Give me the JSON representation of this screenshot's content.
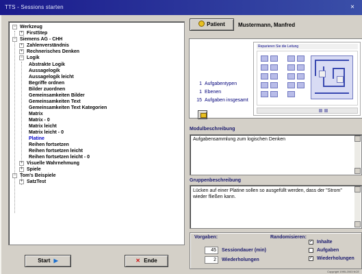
{
  "window": {
    "title": "TTS - Sessions starten",
    "close_glyph": "×"
  },
  "tree": {
    "nodes": [
      {
        "label": "Werkzeug",
        "exp": "−"
      },
      {
        "label": "FirstStep",
        "exp": "+"
      },
      {
        "label": "Siemens AG - CHH",
        "exp": "−"
      },
      {
        "label": "Zahlenverständnis",
        "exp": "+"
      },
      {
        "label": "Rechnerisches Denken",
        "exp": "+"
      },
      {
        "label": "Logik",
        "exp": "−"
      },
      {
        "label": "Abstrakte Logik",
        "exp": ""
      },
      {
        "label": "Aussagelogik",
        "exp": ""
      },
      {
        "label": "Aussagelogik leicht",
        "exp": ""
      },
      {
        "label": "Begriffe ordnen",
        "exp": ""
      },
      {
        "label": "Bilder zuordnen",
        "exp": ""
      },
      {
        "label": "Gemeinsamkeiten Bilder",
        "exp": ""
      },
      {
        "label": "Gemeinsamkeiten Text",
        "exp": ""
      },
      {
        "label": "Gemeinsamkeiten Text Kategorien",
        "exp": ""
      },
      {
        "label": "Matrix",
        "exp": ""
      },
      {
        "label": "Matrix - 0",
        "exp": ""
      },
      {
        "label": "Matrix leicht",
        "exp": ""
      },
      {
        "label": "Matrix leicht - 0",
        "exp": ""
      },
      {
        "label": "Platine",
        "exp": "",
        "selected": true
      },
      {
        "label": "Reihen fortsetzen",
        "exp": ""
      },
      {
        "label": "Reihen fortsetzen leicht",
        "exp": ""
      },
      {
        "label": "Reihen fortsetzen leicht - 0",
        "exp": ""
      },
      {
        "label": "Visuelle Wahrnehmung",
        "exp": "+"
      },
      {
        "label": "Spiele",
        "exp": "+"
      },
      {
        "label": "Tom's Beispiele",
        "exp": "−"
      },
      {
        "label": "SatzTest",
        "exp": "+"
      }
    ]
  },
  "buttons": {
    "start": "Start",
    "start_arrow": "▶",
    "end": "Ende",
    "end_glyph": "✕"
  },
  "patient": {
    "button_label": "Patient",
    "name": "Mustermann, Manfred"
  },
  "stats": {
    "aufgabentypen_count": "1",
    "aufgabentypen_label": "Aufgabentypen",
    "ebenen_count": "1",
    "ebenen_label": "Ebenen",
    "aufgaben_count": "15",
    "aufgaben_label": "Aufgaben insgesamt"
  },
  "preview": {
    "header": "Reparieren Sie die Leitung"
  },
  "modul": {
    "label": "Modulbeschreibung",
    "text": "Aufgabensammlung zum logischen Denken"
  },
  "gruppe": {
    "label": "Gruppenbeschreibung",
    "text": "Lücken auf einer Platine sollen so ausgefüllt werden, dass der \"Strom\" wieder fließen kann."
  },
  "vorgaben": {
    "label": "Vorgaben:",
    "sessiondauer_value": "45",
    "sessiondauer_label": "Sessiondauer (min)",
    "wiederholungen_value": "2",
    "wiederholungen_label": "Wiederholungen"
  },
  "randomisieren": {
    "label": "Randomisieren:",
    "options": [
      {
        "label": "Inhalte",
        "checked": true,
        "mark": "✓"
      },
      {
        "label": "Aufgaben",
        "checked": false,
        "mark": ""
      },
      {
        "label": "Wiederholungen",
        "checked": true,
        "mark": "✓"
      }
    ]
  },
  "copyright": "Copyright 1995-2003 NCE"
}
